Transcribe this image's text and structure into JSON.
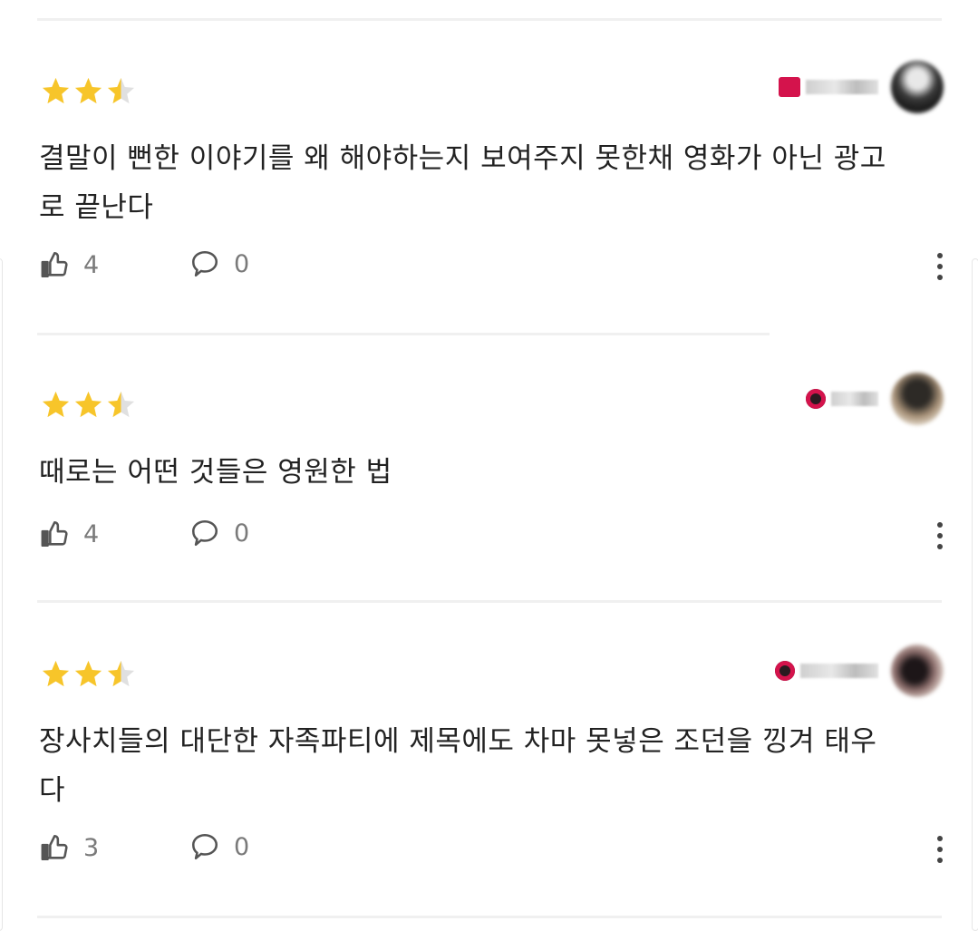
{
  "colors": {
    "star_on": "#f7c52a",
    "star_off": "#e0e0e0",
    "badge": "#d4134c",
    "text": "#222222",
    "meta": "#7a7a7a"
  },
  "reviews": [
    {
      "rating": 2.5,
      "text": "결말이 뻔한 이야기를 왜 해야하는지 보여주지 못한채 영화가 아닌 광고\n로 끝난다",
      "likes": "4",
      "comments": "0"
    },
    {
      "rating": 2.5,
      "text": "때로는 어떤 것들은 영원한 법",
      "likes": "4",
      "comments": "0"
    },
    {
      "rating": 2.5,
      "text": "장사치들의 대단한 자족파티에 제목에도 차마 못넣은 조던을 낑겨 태우\n다",
      "likes": "3",
      "comments": "0"
    }
  ]
}
